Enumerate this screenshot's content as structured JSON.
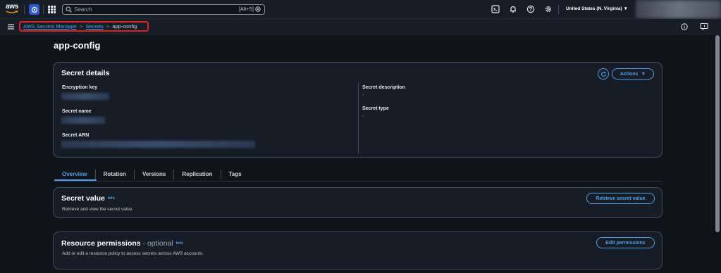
{
  "topnav": {
    "logo_text": "aws",
    "search_placeholder": "Search",
    "search_shortcut": "[Alt+S]",
    "region": "United States (N. Virginia) ▼",
    "icons": [
      "services-grid-icon",
      "cloudshell-icon",
      "bell-icon",
      "help-icon",
      "settings-icon"
    ]
  },
  "breadcrumb": {
    "items": [
      "AWS Secrets Manager",
      "Secrets",
      "app-config"
    ],
    "separator": ">",
    "highlight_color": "#e02020"
  },
  "page": {
    "title": "app-config"
  },
  "details": {
    "heading": "Secret details",
    "actions_label": "Actions",
    "encryption_key_label": "Encryption key",
    "secret_name_label": "Secret name",
    "secret_arn_label": "Secret ARN",
    "description_label": "Secret description",
    "description_value": "-",
    "type_label": "Secret type",
    "type_value": "-"
  },
  "tabs": [
    {
      "label": "Overview",
      "active": true
    },
    {
      "label": "Rotation",
      "active": false
    },
    {
      "label": "Versions",
      "active": false
    },
    {
      "label": "Replication",
      "active": false
    },
    {
      "label": "Tags",
      "active": false
    }
  ],
  "secret_value": {
    "heading": "Secret value",
    "info": "Info",
    "description": "Retrieve and view the secret value.",
    "button": "Retrieve secret value"
  },
  "permissions": {
    "heading": "Resource permissions",
    "optional": " - optional",
    "info": "Info",
    "description": "Add or edit a resource policy to access secrets across AWS accounts.",
    "button": "Edit permissions"
  },
  "colors": {
    "accent": "#539fe5",
    "background": "#0f141a",
    "card": "#161d26"
  }
}
